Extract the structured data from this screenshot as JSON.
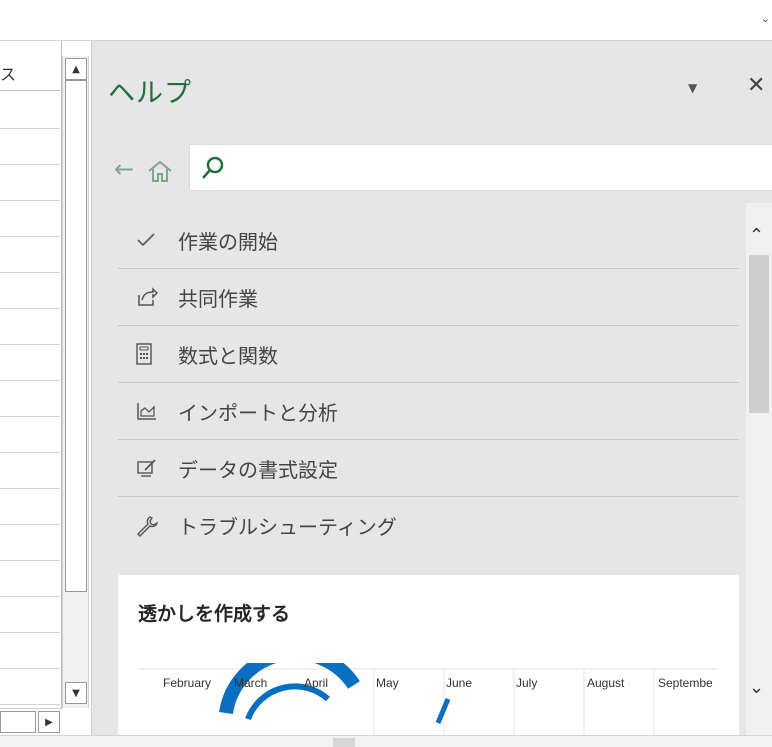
{
  "topbar": {
    "chevron_icon": "chevron-down-icon"
  },
  "sheet": {
    "header_fragment": "ス"
  },
  "help": {
    "title": "ヘルプ",
    "search_placeholder": "",
    "nav_back_icon": "arrow-left-icon",
    "nav_home_icon": "home-icon",
    "items": [
      {
        "label": "作業の開始",
        "icon": "checkmark-icon"
      },
      {
        "label": "共同作業",
        "icon": "share-icon"
      },
      {
        "label": "数式と関数",
        "icon": "calculator-icon"
      },
      {
        "label": "インポートと分析",
        "icon": "chart-icon"
      },
      {
        "label": "データの書式設定",
        "icon": "format-icon"
      },
      {
        "label": "トラブルシューティング",
        "icon": "wrench-icon"
      }
    ],
    "card": {
      "title": "透かしを作成する",
      "months": [
        "February",
        "March",
        "April",
        "May",
        "June",
        "July",
        "August",
        "Septembe"
      ]
    }
  },
  "colors": {
    "accent": "#21703a",
    "watermark": "#0a6ec2"
  }
}
